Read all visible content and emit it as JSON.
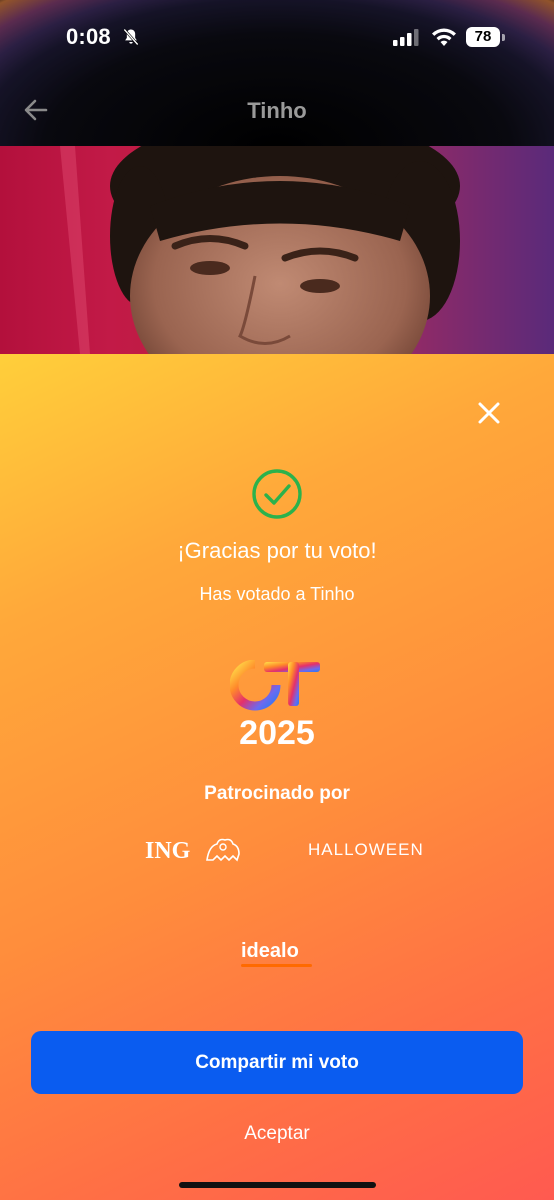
{
  "status_bar": {
    "time": "0:08",
    "battery": "78"
  },
  "nav": {
    "title": "Tinho"
  },
  "modal": {
    "title": "¡Gracias por tu voto!",
    "subtitle": "Has votado a Tinho",
    "show_logo_line1": "OT",
    "show_logo_line2": "2025",
    "sponsored_label": "Patrocinado por",
    "sponsors": [
      "ING",
      "HALLOWEEN",
      "idealo"
    ],
    "share_button": "Compartir mi voto",
    "accept_button": "Aceptar"
  },
  "colors": {
    "primary_button": "#0a5cf0",
    "success_check": "#2bb24c",
    "sheet_gradient_start": "#ffcf3a",
    "sheet_gradient_end": "#ff5a50"
  }
}
